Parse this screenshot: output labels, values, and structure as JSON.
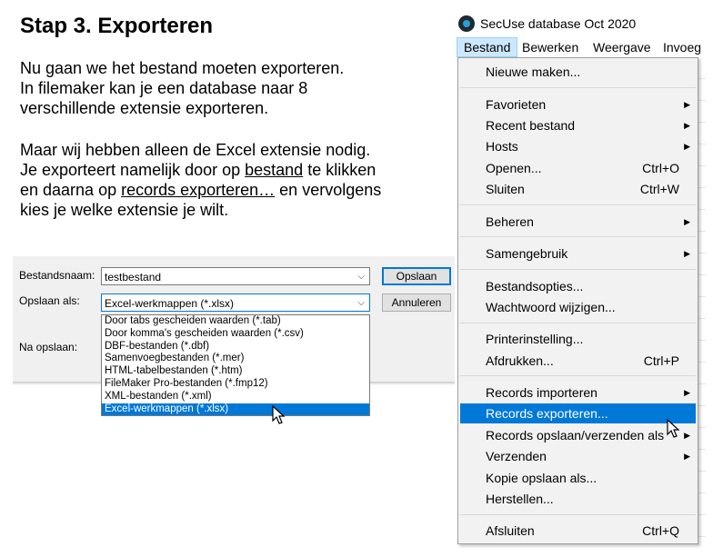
{
  "heading": "Stap 3. Exporteren",
  "intro": {
    "line1": "Nu gaan we het bestand moeten exporteren.",
    "line2": "In filemaker kan je een database naar 8",
    "line3": "verschillende extensie exporteren."
  },
  "explain": {
    "line1": "Maar wij hebben alleen de Excel extensie nodig.",
    "line2a": "Je exporteert namelijk door op ",
    "line2b": "bestand",
    "line2c": " te klikken",
    "line3a": "en daarna op ",
    "line3b": "records exporteren…",
    "line3c": " en vervolgens",
    "line4": "kies je welke extensie je wilt."
  },
  "save_dialog": {
    "filename_label": "Bestandsnaam:",
    "filename_value": "testbestand",
    "save_as_label": "Opslaan als:",
    "save_as_value": "Excel-werkmappen (*.xlsx)",
    "after_save_label": "Na opslaan:",
    "save_button": "Opslaan",
    "cancel_button": "Annuleren",
    "options": [
      "Door tabs gescheiden waarden (*.tab)",
      "Door komma's gescheiden waarden (*.csv)",
      "DBF-bestanden (*.dbf)",
      "Samenvoegbestanden (*.mer)",
      "HTML-tabelbestanden (*.htm)",
      "FileMaker Pro-bestanden (*.fmp12)",
      "XML-bestanden (*.xml)",
      "Excel-werkmappen (*.xlsx)"
    ],
    "selected_index": 7
  },
  "app": {
    "title": "SecUse database Oct 2020",
    "menubar": [
      "Bestand",
      "Bewerken",
      "Weergave",
      "Invoeg"
    ],
    "active_menu": "Bestand"
  },
  "file_menu": [
    {
      "label": "Nieuwe maken..."
    },
    {
      "label": "Favorieten",
      "submenu": true
    },
    {
      "label": "Recent bestand",
      "submenu": true
    },
    {
      "label": "Hosts",
      "submenu": true
    },
    {
      "label": "Openen...",
      "shortcut": "Ctrl+O"
    },
    {
      "label": "Sluiten",
      "shortcut": "Ctrl+W"
    },
    {
      "label": "Beheren",
      "submenu": true
    },
    {
      "label": "Samengebruik",
      "submenu": true
    },
    {
      "label": "Bestandsopties..."
    },
    {
      "label": "Wachtwoord wijzigen..."
    },
    {
      "label": "Printerinstelling..."
    },
    {
      "label": "Afdrukken...",
      "shortcut": "Ctrl+P"
    },
    {
      "label": "Records importeren",
      "submenu": true
    },
    {
      "label": "Records exporteren...",
      "highlighted": true
    },
    {
      "label": "Records opslaan/verzenden als",
      "submenu": true
    },
    {
      "label": "Verzenden",
      "submenu": true
    },
    {
      "label": "Kopie opslaan als..."
    },
    {
      "label": "Herstellen..."
    },
    {
      "label": "Afsluiten",
      "shortcut": "Ctrl+Q"
    }
  ],
  "icons": {
    "submenu_arrow": "▶",
    "combo_arrow": "⌵"
  },
  "colors": {
    "highlight": "#0078d7",
    "menu_bg": "#f2f2f2",
    "dialog_bg": "#f0f0f0"
  }
}
